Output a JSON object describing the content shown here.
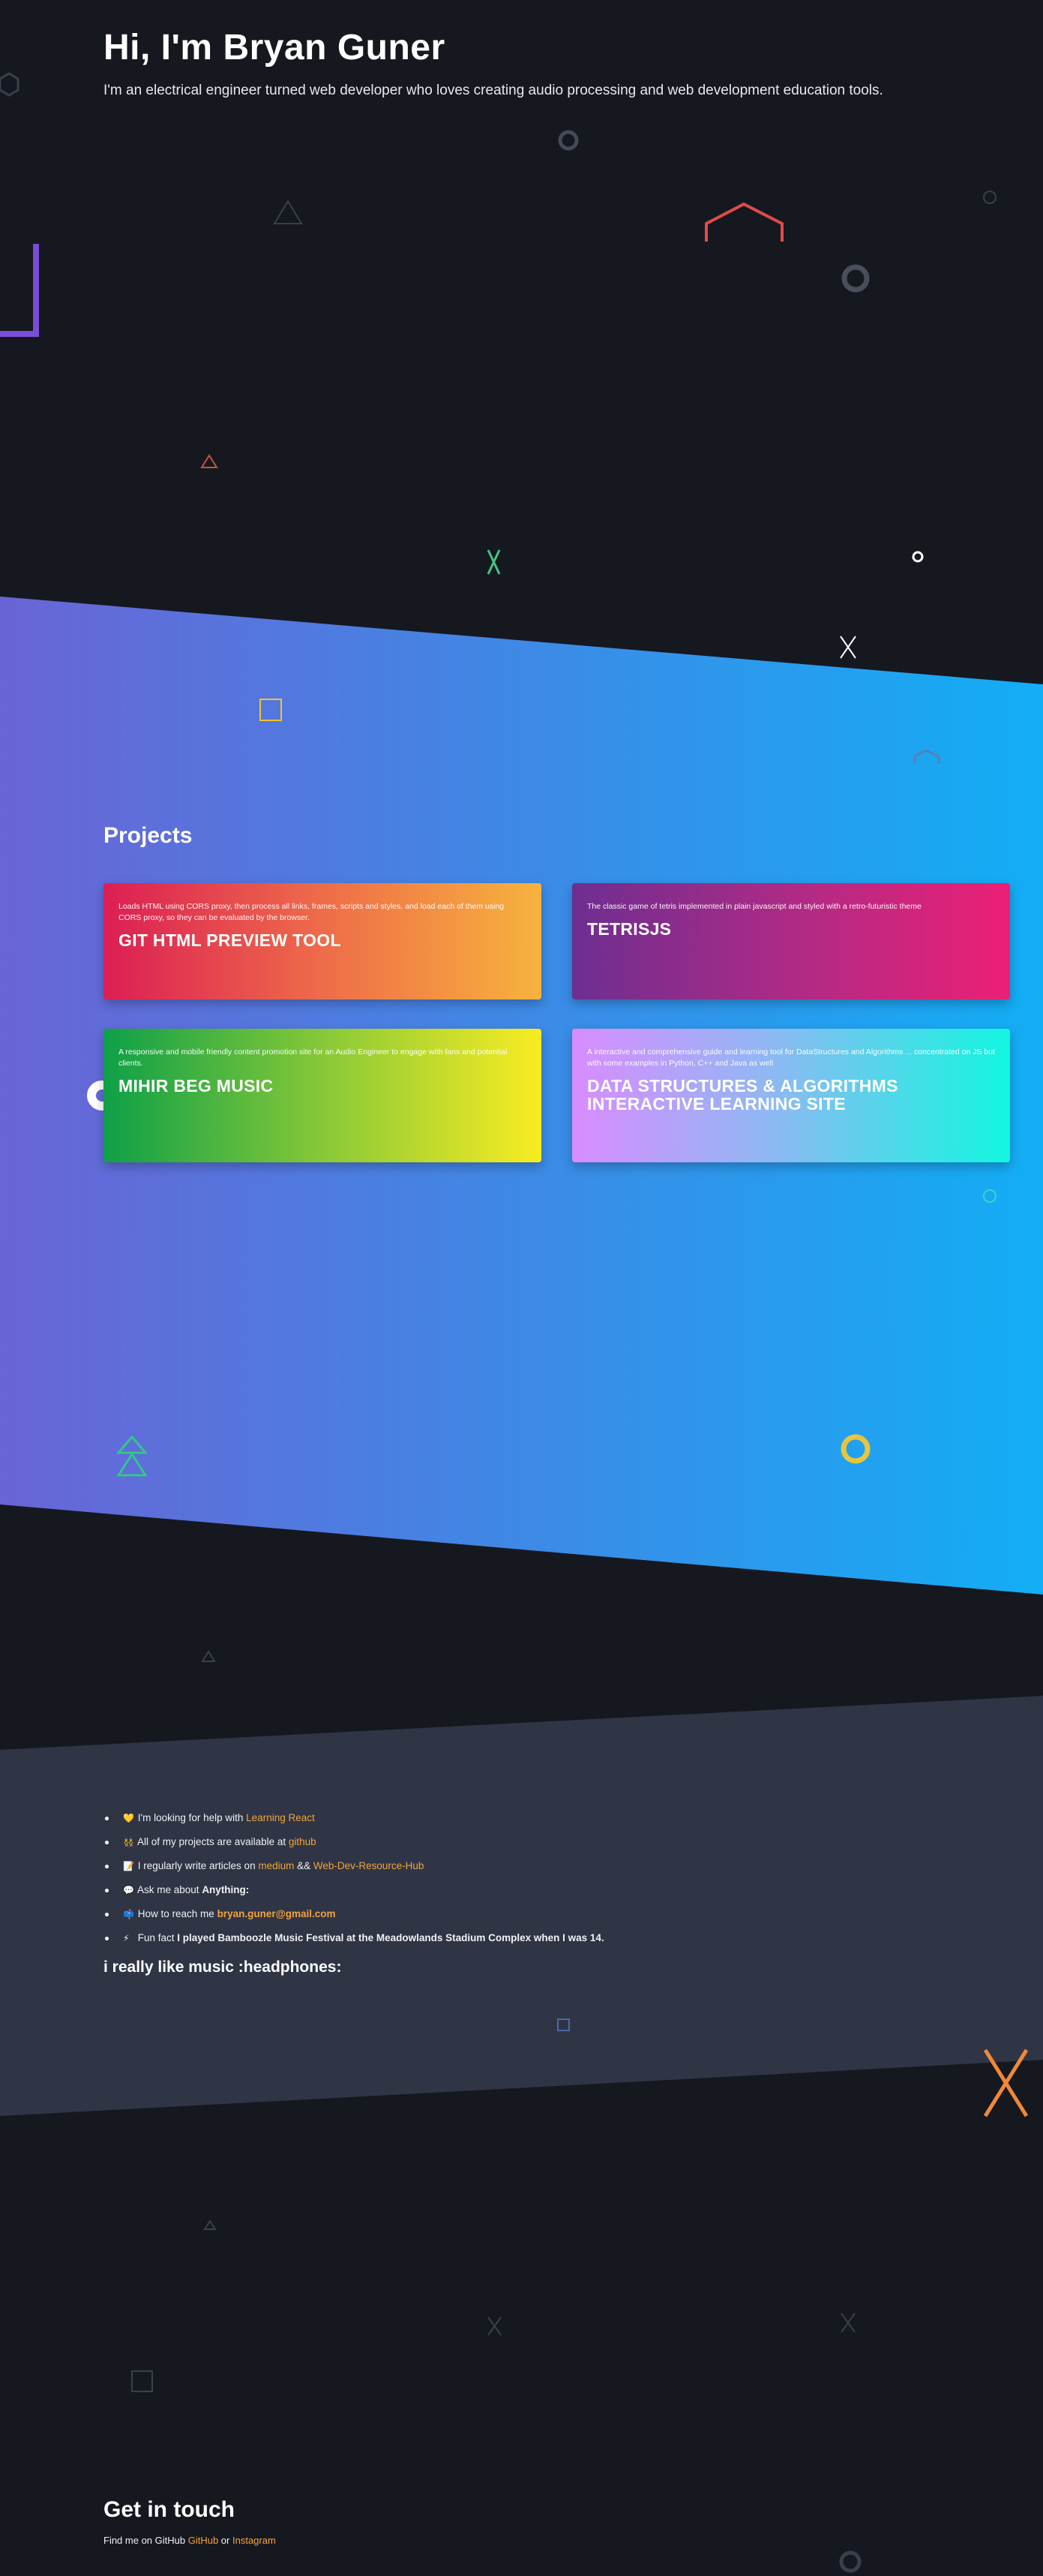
{
  "hero": {
    "title": "Hi, I'm Bryan Guner",
    "subtitle": "I'm an electrical engineer turned web developer who loves creating audio processing and web development education tools."
  },
  "projects": {
    "title": "Projects",
    "cards": [
      {
        "name": "GIT HTML PREVIEW TOOL",
        "description": "Loads HTML using CORS proxy, then process all links, frames, scripts and styles, and load each of them using CORS proxy, so they can be evaluated by the browser.",
        "gradient": [
          "#dc1e54",
          "#f7b33d"
        ]
      },
      {
        "name": "TETRISJS",
        "description": "The classic game of tetris implemented in plain javascript and styled with a retro-futuristic theme",
        "gradient": [
          "#6d2e91",
          "#ec1f75"
        ]
      },
      {
        "name": "MIHIR BEG MUSIC",
        "description": "A responsive and mobile friendly content promotion site for an Audio Engineer to engage with fans and potential clients.",
        "gradient": [
          "#0ea048",
          "#f9ec21"
        ]
      },
      {
        "name": "DATA STRUCTURES & ALGORITHMS INTERACTIVE LEARNING SITE",
        "description": "A interactive and comprehensive guide and learning tool for DataStructures and Algorithms ... concentrated on JS but with some examples in Python, C++ and Java as well",
        "gradient": [
          "#d98cff",
          "#12f6e0"
        ]
      }
    ]
  },
  "about": {
    "items": [
      {
        "emoji": "💛",
        "text": "I'm looking for help with ",
        "link": "Learning React"
      },
      {
        "emoji": "👯",
        "text": "All of my projects are available at ",
        "link": "github"
      },
      {
        "emoji": "📝",
        "text": "I regularly write articles on ",
        "link": "medium",
        "mid": " && ",
        "link2": "Web-Dev-Resource-Hub"
      },
      {
        "emoji": "💬",
        "text": "Ask me about ",
        "bold": "Anything:"
      },
      {
        "emoji": "📫",
        "text": "How to reach me ",
        "link": "bryan.guner@gmail.com"
      },
      {
        "emoji": "⚡",
        "text": "Fun fact ",
        "bold": "I played Bamboozle Music Festival at the Meadowlands Stadium Complex when I was 14."
      }
    ],
    "music_heading": "i really like music :headphones:"
  },
  "contact": {
    "title": "Get in touch",
    "prefix": "Find me on GitHub ",
    "github": "GitHub",
    "or": " or ",
    "instagram": "Instagram"
  },
  "colors": {
    "background": "#161820",
    "band_gradient": [
      "#6a64d6",
      "#12aef5"
    ],
    "about_band": "#2f3545",
    "link": "#f2a33c"
  },
  "icons": [
    "hexagon-icon",
    "circle-icon",
    "triangle-icon",
    "x-icon",
    "square-icon",
    "arrow-up-icon",
    "bracket-icon"
  ]
}
